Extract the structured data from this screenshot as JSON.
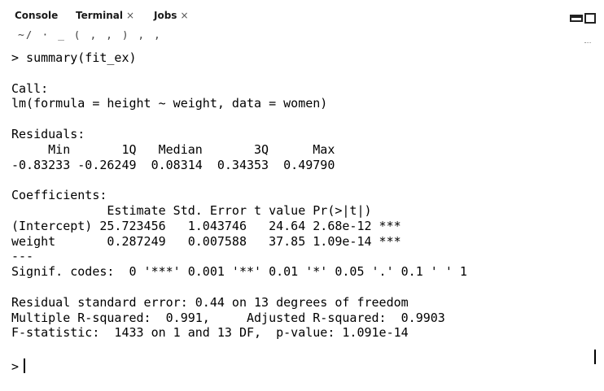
{
  "tabs": [
    {
      "label": "Console",
      "closable": false
    },
    {
      "label": "Terminal",
      "closable": true
    },
    {
      "label": "Jobs",
      "closable": true
    }
  ],
  "close_glyph": "×",
  "console": {
    "partial_top_line": "~/  ·   _   (   ,   ,   )   ,   ,",
    "lines": [
      "> summary(fit_ex)",
      "",
      "Call:",
      "lm(formula = height ~ weight, data = women)",
      "",
      "Residuals:",
      "     Min       1Q   Median       3Q      Max ",
      "-0.83233 -0.26249  0.08314  0.34353  0.49790 ",
      "",
      "Coefficients:",
      "             Estimate Std. Error t value Pr(>|t|)    ",
      "(Intercept) 25.723456   1.043746   24.64 2.68e-12 ***",
      "weight       0.287249   0.007588   37.85 1.09e-14 ***",
      "---",
      "Signif. codes:  0 '***' 0.001 '**' 0.01 '*' 0.05 '.' 0.1 ' ' 1",
      "",
      "Residual standard error: 0.44 on 13 degrees of freedom",
      "Multiple R-squared:  0.991,\tAdjusted R-squared:  0.9903 ",
      "F-statistic:  1433 on 1 and 13 DF,  p-value: 1.091e-14",
      ""
    ],
    "prompt": ">"
  }
}
